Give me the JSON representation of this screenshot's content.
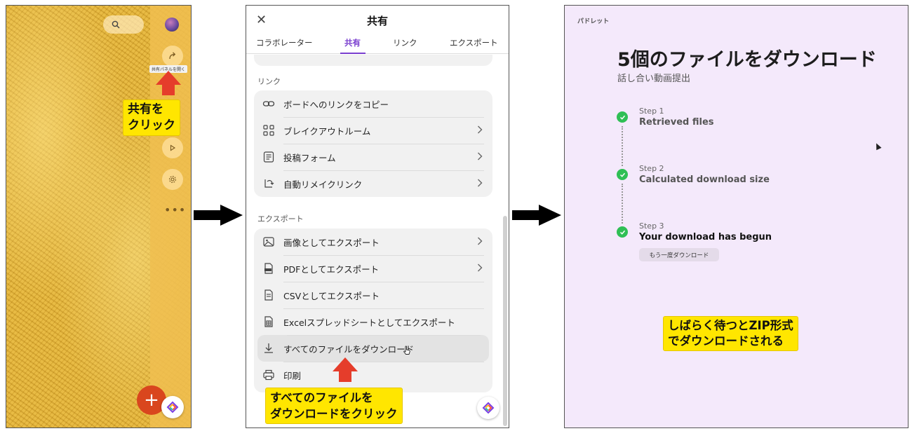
{
  "panel1": {
    "tooltip": "共有パネルを開く",
    "callout": [
      "共有を",
      "クリック"
    ]
  },
  "panel2": {
    "title": "共有",
    "tabs": [
      "コラボレーター",
      "共有",
      "リンク",
      "エクスポート"
    ],
    "active_tab": "共有",
    "link_section": {
      "label": "リンク",
      "items": [
        {
          "label": "ボードへのリンクをコピー",
          "icon": "link-icon",
          "chevron": false
        },
        {
          "label": "ブレイクアウトルーム",
          "icon": "breakout-icon",
          "chevron": true
        },
        {
          "label": "投稿フォーム",
          "icon": "form-icon",
          "chevron": true
        },
        {
          "label": "自動リメイクリンク",
          "icon": "remake-icon",
          "chevron": true
        }
      ]
    },
    "export_section": {
      "label": "エクスポート",
      "items": [
        {
          "label": "画像としてエクスポート",
          "icon": "image-icon",
          "chevron": true
        },
        {
          "label": "PDFとしてエクスポート",
          "icon": "pdf-icon",
          "chevron": true
        },
        {
          "label": "CSVとしてエクスポート",
          "icon": "csv-icon",
          "chevron": false
        },
        {
          "label": "Excelスプレッドシートとしてエクスポート",
          "icon": "excel-icon",
          "chevron": false
        },
        {
          "label": "すべてのファイルをダウンロード",
          "icon": "download-icon",
          "chevron": false
        },
        {
          "label": "印刷",
          "icon": "print-icon",
          "chevron": false
        }
      ]
    },
    "callout": [
      "すべてのファイルを",
      "ダウンロードをクリック"
    ]
  },
  "panel3": {
    "brand": "パドレット",
    "title": "5個のファイルをダウンロード",
    "subtitle": "話し合い動画提出",
    "steps": [
      {
        "num": "Step 1",
        "text": "Retrieved files"
      },
      {
        "num": "Step 2",
        "text": "Calculated download size"
      },
      {
        "num": "Step 3",
        "text": "Your download has begun"
      }
    ],
    "again_button": "もう一度ダウンロード",
    "callout": [
      "しばらく待つとZIP形式",
      "でダウンロードされる"
    ]
  },
  "colors": {
    "accent_red": "#e53d2b",
    "callout_yellow": "#ffe600",
    "tab_purple": "#7a3fcf",
    "check_green": "#2fbf55"
  }
}
